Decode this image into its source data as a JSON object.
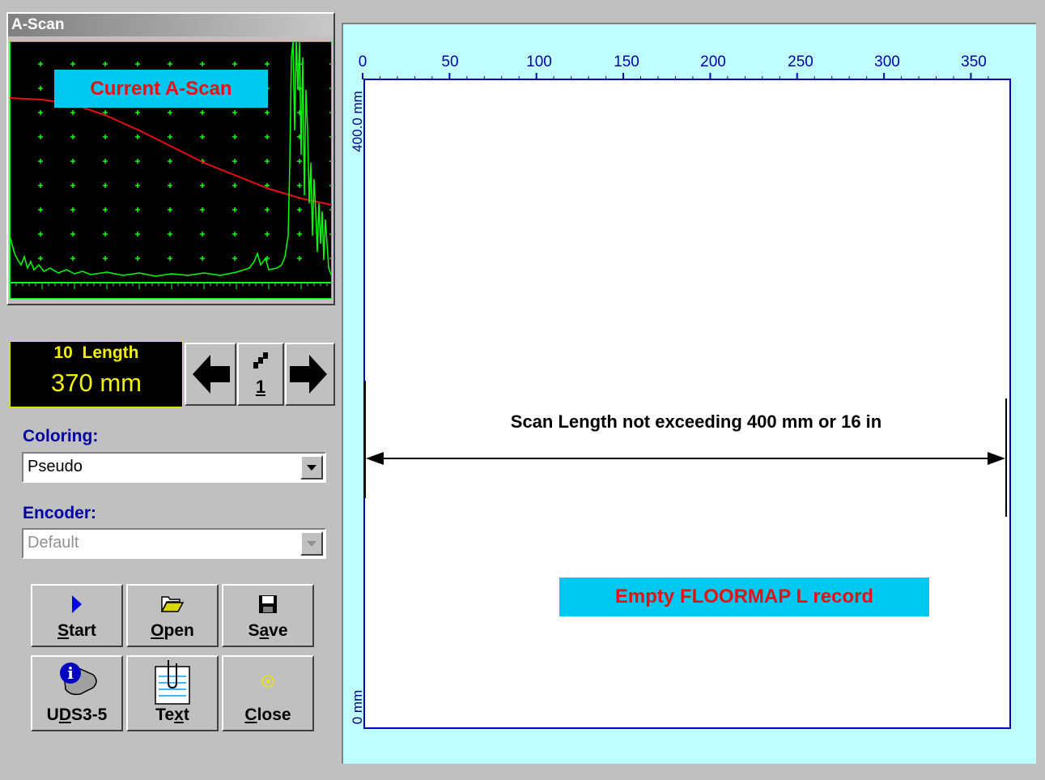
{
  "ascan": {
    "window_title": "A-Scan",
    "overlay_label": "Current A-Scan"
  },
  "parameter": {
    "title": "10  Length",
    "value": "370 mm",
    "step_value": "1"
  },
  "coloring": {
    "label": "Coloring:",
    "selected": "Pseudo"
  },
  "encoder": {
    "label": "Encoder:",
    "selected": "Default"
  },
  "buttons": {
    "start": "Start",
    "open": "Open",
    "save": "Save",
    "uds": "UDS3-5",
    "text": "Text",
    "close": "Close"
  },
  "floormap": {
    "x_ticks": [
      "0",
      "50",
      "100",
      "150",
      "200",
      "250",
      "300",
      "350"
    ],
    "y_top_label": "400.0 mm",
    "y_bottom_label": "0 mm",
    "annotation": "Scan Length not exceeding 400 mm or 16 in",
    "empty_label": "Empty FLOORMAP L record"
  },
  "colors": {
    "accent_cyan": "#00c8f0",
    "label_red": "#e81010",
    "grid_green": "#00ff00",
    "param_yellow": "#f0f000"
  }
}
